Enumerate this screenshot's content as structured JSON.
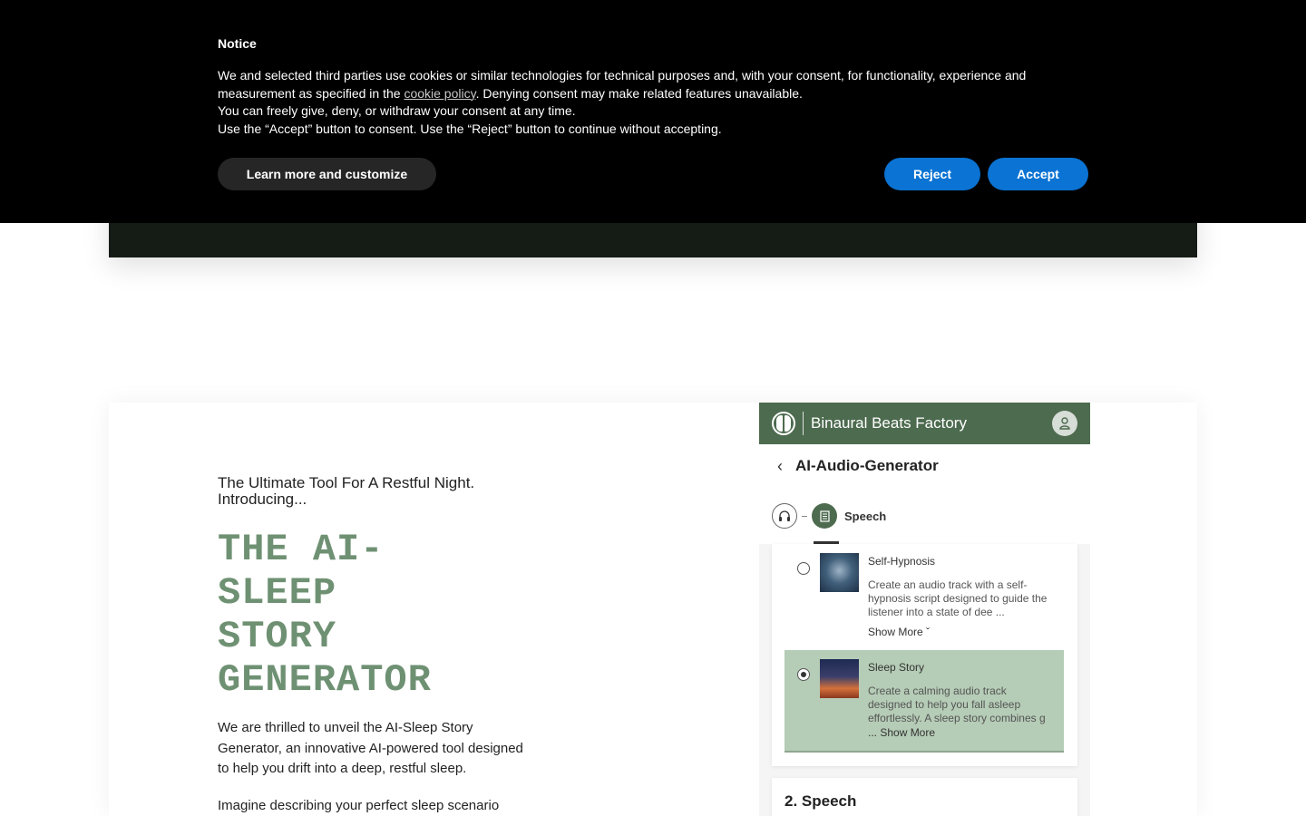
{
  "cookie_banner": {
    "title": "Notice",
    "line1_before_link": "We and selected third parties use cookies or similar technologies for technical purposes and, with your consent, for functionality, experience and measurement as specified in the ",
    "link_text": "cookie policy",
    "line1_after_link": ". Denying consent may make related features unavailable.",
    "line2": "You can freely give, deny, or withdraw your consent at any time.",
    "line3": "Use the “Accept” button to consent. Use the “Reject” button to continue without accepting.",
    "learn_more_label": "Learn more and customize",
    "reject_label": "Reject",
    "accept_label": "Accept"
  },
  "hero": {
    "tagline_line1": "The Ultimate Tool For A Restful Night.",
    "tagline_line2": "Introducing...",
    "title_lines": [
      "THE AI-",
      "SLEEP",
      "STORY",
      "GENERATOR"
    ],
    "intro": "We are thrilled to unveil the AI-Sleep Story Generator, an innovative AI-powered tool designed to help you drift into a deep, restful sleep.",
    "intro2": "Imagine describing your perfect sleep scenario"
  },
  "app_screenshot": {
    "brand": "Binaural Beats Factory",
    "page_title": "AI-Audio-Generator",
    "back_glyph": "‹",
    "step_active_label": "Speech",
    "options": [
      {
        "title": "Self-Hypnosis",
        "description": "Create an audio track with a self-hypnosis script designed to guide the listener into a state of dee ...",
        "more": "Show More ˇ",
        "selected": false
      },
      {
        "title": "Sleep Story",
        "description": "Create a calming audio track designed to help you fall asleep effortlessly. A sleep story combines g",
        "more": "... Show More",
        "selected": true
      }
    ],
    "section2_title": "2. Speech"
  },
  "colors": {
    "banner_bg": "#000000",
    "button_blue": "#0a73d3",
    "title_green": "#6f9173",
    "app_bar_green": "#4d6b4f",
    "selected_option_bg": "#b5ccb6"
  }
}
